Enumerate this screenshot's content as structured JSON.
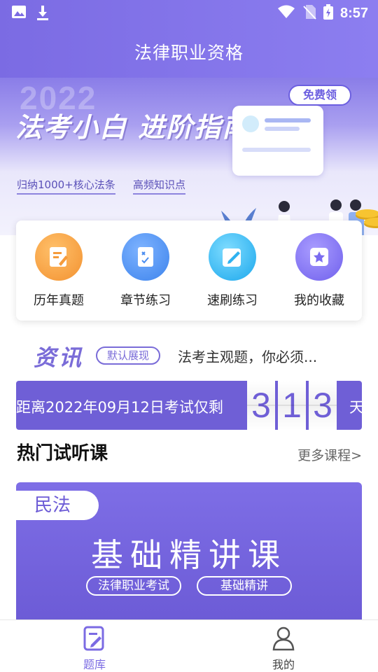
{
  "status_bar": {
    "time": "8:57"
  },
  "header": {
    "title": "法律职业资格"
  },
  "banner": {
    "year": "2022",
    "headline": "法考小白 进阶指南",
    "tags": [
      "归纳1000+核心法条",
      "高频知识点"
    ],
    "free_label": "免费领"
  },
  "quick_actions": [
    {
      "label": "历年真题",
      "color": "#f59b3c",
      "icon": "document-edit-icon"
    },
    {
      "label": "章节练习",
      "color": "#4a8df0",
      "icon": "checklist-icon"
    },
    {
      "label": "速刷练习",
      "color": "#2fb2f0",
      "icon": "pencil-icon"
    },
    {
      "label": "我的收藏",
      "color": "#7b6cf0",
      "icon": "star-folder-icon"
    }
  ],
  "news": {
    "logo": "资讯",
    "badge": "默认展现",
    "headline": "法考主观题，你必须..."
  },
  "countdown": {
    "text": "距离2022年09月12日考试仅剩",
    "digits": [
      "3",
      "1",
      "3"
    ],
    "unit": "天"
  },
  "hot_courses": {
    "title": "热门试听课",
    "more_label": "更多课程>",
    "course": {
      "subject": "民法",
      "title": "基础精讲课",
      "chips": [
        "法律职业考试",
        "基础精讲"
      ]
    }
  },
  "bottom_nav": [
    {
      "label": "题库",
      "active": true
    },
    {
      "label": "我的",
      "active": false
    }
  ],
  "colors": {
    "primary": "#7b6be3",
    "accent": "#6f5fd6"
  }
}
